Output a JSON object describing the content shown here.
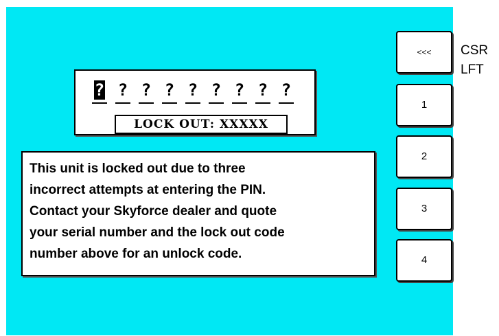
{
  "pin_entry": {
    "digits": [
      "?",
      "?",
      "?",
      "?",
      "?",
      "?",
      "?",
      "?",
      "?"
    ],
    "cursor_index": 0
  },
  "lockout": {
    "label": "LOCK OUT: XXXXX"
  },
  "message": {
    "text": "This unit is locked out due to three\nincorrect attempts at entering the PIN.\nContact your Skyforce dealer and quote\nyour serial number and the lock out code\nnumber above for an unlock code."
  },
  "softkeys": {
    "back_label": "<<<",
    "key1_label": "1",
    "key2_label": "2",
    "key3_label": "3",
    "key4_label": "4"
  },
  "side_label": {
    "line1": "CSR",
    "line2": "LFT"
  },
  "colors": {
    "screen_background": "#00e8f4",
    "panel_background": "#ffffff",
    "text": "#000000"
  }
}
